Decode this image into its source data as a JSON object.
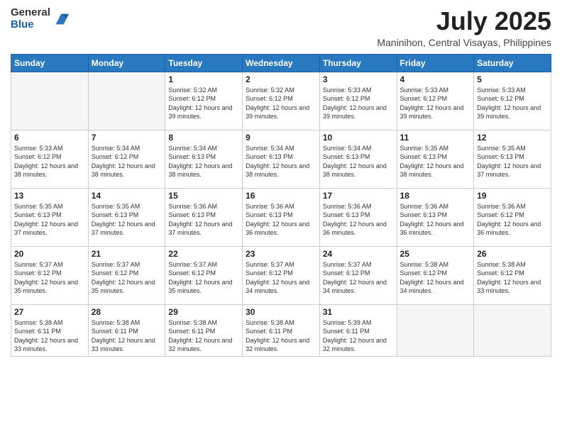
{
  "logo": {
    "general": "General",
    "blue": "Blue"
  },
  "header": {
    "month": "July 2025",
    "location": "Maninihon, Central Visayas, Philippines"
  },
  "days_of_week": [
    "Sunday",
    "Monday",
    "Tuesday",
    "Wednesday",
    "Thursday",
    "Friday",
    "Saturday"
  ],
  "weeks": [
    [
      {
        "day": "",
        "sunrise": "",
        "sunset": "",
        "daylight": ""
      },
      {
        "day": "",
        "sunrise": "",
        "sunset": "",
        "daylight": ""
      },
      {
        "day": "1",
        "sunrise": "Sunrise: 5:32 AM",
        "sunset": "Sunset: 6:12 PM",
        "daylight": "Daylight: 12 hours and 39 minutes."
      },
      {
        "day": "2",
        "sunrise": "Sunrise: 5:32 AM",
        "sunset": "Sunset: 6:12 PM",
        "daylight": "Daylight: 12 hours and 39 minutes."
      },
      {
        "day": "3",
        "sunrise": "Sunrise: 5:33 AM",
        "sunset": "Sunset: 6:12 PM",
        "daylight": "Daylight: 12 hours and 39 minutes."
      },
      {
        "day": "4",
        "sunrise": "Sunrise: 5:33 AM",
        "sunset": "Sunset: 6:12 PM",
        "daylight": "Daylight: 12 hours and 39 minutes."
      },
      {
        "day": "5",
        "sunrise": "Sunrise: 5:33 AM",
        "sunset": "Sunset: 6:12 PM",
        "daylight": "Daylight: 12 hours and 39 minutes."
      }
    ],
    [
      {
        "day": "6",
        "sunrise": "Sunrise: 5:33 AM",
        "sunset": "Sunset: 6:12 PM",
        "daylight": "Daylight: 12 hours and 38 minutes."
      },
      {
        "day": "7",
        "sunrise": "Sunrise: 5:34 AM",
        "sunset": "Sunset: 6:12 PM",
        "daylight": "Daylight: 12 hours and 38 minutes."
      },
      {
        "day": "8",
        "sunrise": "Sunrise: 5:34 AM",
        "sunset": "Sunset: 6:13 PM",
        "daylight": "Daylight: 12 hours and 38 minutes."
      },
      {
        "day": "9",
        "sunrise": "Sunrise: 5:34 AM",
        "sunset": "Sunset: 6:13 PM",
        "daylight": "Daylight: 12 hours and 38 minutes."
      },
      {
        "day": "10",
        "sunrise": "Sunrise: 5:34 AM",
        "sunset": "Sunset: 6:13 PM",
        "daylight": "Daylight: 12 hours and 38 minutes."
      },
      {
        "day": "11",
        "sunrise": "Sunrise: 5:35 AM",
        "sunset": "Sunset: 6:13 PM",
        "daylight": "Daylight: 12 hours and 38 minutes."
      },
      {
        "day": "12",
        "sunrise": "Sunrise: 5:35 AM",
        "sunset": "Sunset: 6:13 PM",
        "daylight": "Daylight: 12 hours and 37 minutes."
      }
    ],
    [
      {
        "day": "13",
        "sunrise": "Sunrise: 5:35 AM",
        "sunset": "Sunset: 6:13 PM",
        "daylight": "Daylight: 12 hours and 37 minutes."
      },
      {
        "day": "14",
        "sunrise": "Sunrise: 5:35 AM",
        "sunset": "Sunset: 6:13 PM",
        "daylight": "Daylight: 12 hours and 37 minutes."
      },
      {
        "day": "15",
        "sunrise": "Sunrise: 5:36 AM",
        "sunset": "Sunset: 6:13 PM",
        "daylight": "Daylight: 12 hours and 37 minutes."
      },
      {
        "day": "16",
        "sunrise": "Sunrise: 5:36 AM",
        "sunset": "Sunset: 6:13 PM",
        "daylight": "Daylight: 12 hours and 36 minutes."
      },
      {
        "day": "17",
        "sunrise": "Sunrise: 5:36 AM",
        "sunset": "Sunset: 6:13 PM",
        "daylight": "Daylight: 12 hours and 36 minutes."
      },
      {
        "day": "18",
        "sunrise": "Sunrise: 5:36 AM",
        "sunset": "Sunset: 6:13 PM",
        "daylight": "Daylight: 12 hours and 36 minutes."
      },
      {
        "day": "19",
        "sunrise": "Sunrise: 5:36 AM",
        "sunset": "Sunset: 6:12 PM",
        "daylight": "Daylight: 12 hours and 36 minutes."
      }
    ],
    [
      {
        "day": "20",
        "sunrise": "Sunrise: 5:37 AM",
        "sunset": "Sunset: 6:12 PM",
        "daylight": "Daylight: 12 hours and 35 minutes."
      },
      {
        "day": "21",
        "sunrise": "Sunrise: 5:37 AM",
        "sunset": "Sunset: 6:12 PM",
        "daylight": "Daylight: 12 hours and 35 minutes."
      },
      {
        "day": "22",
        "sunrise": "Sunrise: 5:37 AM",
        "sunset": "Sunset: 6:12 PM",
        "daylight": "Daylight: 12 hours and 35 minutes."
      },
      {
        "day": "23",
        "sunrise": "Sunrise: 5:37 AM",
        "sunset": "Sunset: 6:12 PM",
        "daylight": "Daylight: 12 hours and 34 minutes."
      },
      {
        "day": "24",
        "sunrise": "Sunrise: 5:37 AM",
        "sunset": "Sunset: 6:12 PM",
        "daylight": "Daylight: 12 hours and 34 minutes."
      },
      {
        "day": "25",
        "sunrise": "Sunrise: 5:38 AM",
        "sunset": "Sunset: 6:12 PM",
        "daylight": "Daylight: 12 hours and 34 minutes."
      },
      {
        "day": "26",
        "sunrise": "Sunrise: 5:38 AM",
        "sunset": "Sunset: 6:12 PM",
        "daylight": "Daylight: 12 hours and 33 minutes."
      }
    ],
    [
      {
        "day": "27",
        "sunrise": "Sunrise: 5:38 AM",
        "sunset": "Sunset: 6:11 PM",
        "daylight": "Daylight: 12 hours and 33 minutes."
      },
      {
        "day": "28",
        "sunrise": "Sunrise: 5:38 AM",
        "sunset": "Sunset: 6:11 PM",
        "daylight": "Daylight: 12 hours and 33 minutes."
      },
      {
        "day": "29",
        "sunrise": "Sunrise: 5:38 AM",
        "sunset": "Sunset: 6:11 PM",
        "daylight": "Daylight: 12 hours and 32 minutes."
      },
      {
        "day": "30",
        "sunrise": "Sunrise: 5:38 AM",
        "sunset": "Sunset: 6:11 PM",
        "daylight": "Daylight: 12 hours and 32 minutes."
      },
      {
        "day": "31",
        "sunrise": "Sunrise: 5:39 AM",
        "sunset": "Sunset: 6:11 PM",
        "daylight": "Daylight: 12 hours and 32 minutes."
      },
      {
        "day": "",
        "sunrise": "",
        "sunset": "",
        "daylight": ""
      },
      {
        "day": "",
        "sunrise": "",
        "sunset": "",
        "daylight": ""
      }
    ]
  ]
}
